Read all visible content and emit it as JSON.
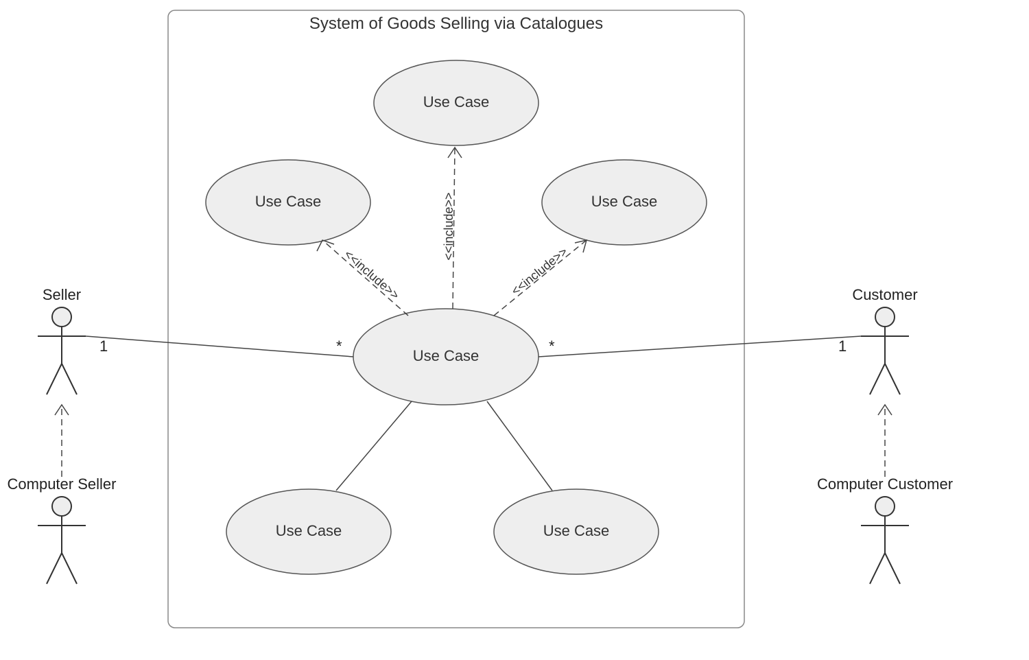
{
  "system": {
    "title": "System of Goods Selling via Catalogues"
  },
  "usecases": {
    "top": "Use Case",
    "topleft": "Use Case",
    "topright": "Use Case",
    "center": "Use Case",
    "bottomleft": "Use Case",
    "bottomright": "Use Case"
  },
  "actors": {
    "seller": "Seller",
    "computer_seller": "Computer Seller",
    "customer": "Customer",
    "computer_customer": "Computer Customer"
  },
  "multiplicities": {
    "seller_side": "1",
    "seller_usecase": "*",
    "customer_side": "1",
    "customer_usecase": "*"
  },
  "stereotypes": {
    "include1": "<<include>>",
    "include2": "<<include>>",
    "include3": "<<include>>"
  }
}
